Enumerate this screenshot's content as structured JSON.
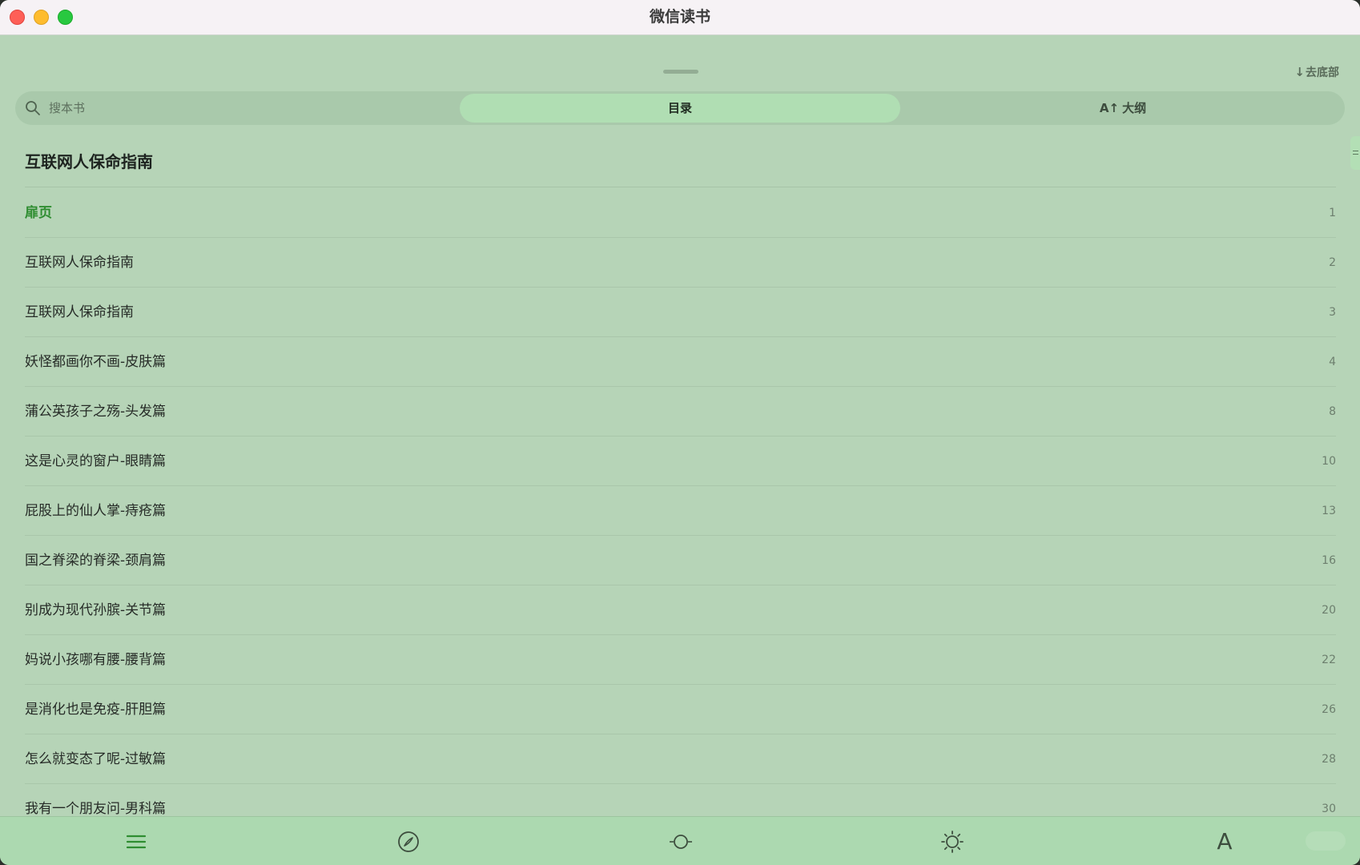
{
  "window": {
    "title": "微信读书"
  },
  "panel": {
    "goto_bottom": "去底部",
    "goto_bottom_arrow": "↓",
    "search_placeholder": "搜本书",
    "tabs": [
      {
        "label": "目录",
        "selected": true
      },
      {
        "label": "大纲",
        "icon": "ai-outline-icon",
        "icon_text": "A↑"
      }
    ]
  },
  "book_title": "互联网人保命指南",
  "toc": [
    {
      "label": "扉页",
      "page": "1",
      "active": true
    },
    {
      "label": "互联网人保命指南",
      "page": "2"
    },
    {
      "label": "互联网人保命指南",
      "page": "3"
    },
    {
      "label": "妖怪都画你不画-皮肤篇",
      "page": "4"
    },
    {
      "label": "蒲公英孩子之殇-头发篇",
      "page": "8"
    },
    {
      "label": "这是心灵的窗户-眼睛篇",
      "page": "10"
    },
    {
      "label": "屁股上的仙人掌-痔疮篇",
      "page": "13"
    },
    {
      "label": "国之脊梁的脊梁-颈肩篇",
      "page": "16"
    },
    {
      "label": "别成为现代孙膑-关节篇",
      "page": "20"
    },
    {
      "label": "妈说小孩哪有腰-腰背篇",
      "page": "22"
    },
    {
      "label": "是消化也是免疫-肝胆篇",
      "page": "26"
    },
    {
      "label": "怎么就变态了呢-过敏篇",
      "page": "28"
    },
    {
      "label": "我有一个朋友问-男科篇",
      "page": "30"
    }
  ],
  "bottom_bar": {
    "buttons": [
      {
        "name": "toc-button",
        "icon": "list-icon"
      },
      {
        "name": "discover-button",
        "icon": "compass-icon"
      },
      {
        "name": "progress-button",
        "icon": "progress-slider-icon"
      },
      {
        "name": "brightness-button",
        "icon": "sun-icon"
      },
      {
        "name": "font-button",
        "icon": "font-icon",
        "label": "A"
      }
    ]
  },
  "colors": {
    "background": "#b6d4b7",
    "accent": "#2f8d31",
    "selected_tab": "#b0deb3",
    "bottom_bar": "#acd9b0"
  }
}
